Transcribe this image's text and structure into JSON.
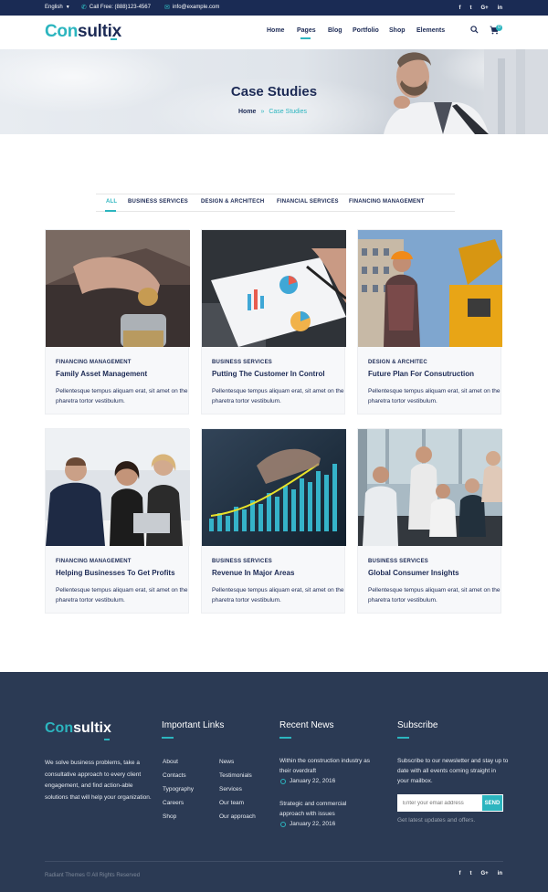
{
  "topbar": {
    "language": "English",
    "phone": "Call Free: (888)123-4567",
    "email": "info@example.com",
    "social": [
      "f",
      "t",
      "G+",
      "in"
    ]
  },
  "header": {
    "logo_part1": "Con",
    "logo_part2": "sultix",
    "nav": [
      "Home",
      "Pages",
      "Blog",
      "Portfolio",
      "Shop",
      "Elements"
    ],
    "active_nav": "Pages",
    "cart_count": "0"
  },
  "hero": {
    "title": "Case Studies",
    "breadcrumb_home": "Home",
    "breadcrumb_sep": "»",
    "breadcrumb_current": "Case Studies"
  },
  "filters": [
    "ALL",
    "BUSINESS SERVICES",
    "DESIGN & ARCHITECH",
    "FINANCIAL SERVICES",
    "FINANCING MANAGEMENT"
  ],
  "cards": [
    {
      "category": "FINANCING MANAGEMENT",
      "title": "Family Asset Management",
      "desc": "Pellentesque tempus aliquam erat, sit amet on the pharetra tortor vestibulum."
    },
    {
      "category": "BUSINESS SERVICES",
      "title": "Putting The Customer In Control",
      "desc": "Pellentesque tempus aliquam erat, sit amet on the pharetra tortor vestibulum."
    },
    {
      "category": "DESIGN & ARCHITEC",
      "title": "Future Plan  For Consutruction",
      "desc": "Pellentesque tempus aliquam erat, sit amet on the pharetra tortor vestibulum."
    },
    {
      "category": "FINANCING MANAGEMENT",
      "title": "Helping Businesses To Get  Profits",
      "desc": "Pellentesque tempus aliquam erat, sit amet on the pharetra tortor vestibulum."
    },
    {
      "category": "BUSINESS SERVICES",
      "title": "Revenue In Major Areas",
      "desc": "Pellentesque tempus aliquam erat, sit amet on the pharetra tortor vestibulum."
    },
    {
      "category": "BUSINESS SERVICES",
      "title": "Global Consumer Insights",
      "desc": "Pellentesque tempus aliquam erat, sit amet on the pharetra tortor vestibulum."
    }
  ],
  "footer": {
    "logo_part1": "Con",
    "logo_part2": "sultix",
    "about": "We solve business problems, take a consultative approach to every client engagement, and find action-able solutions that will help your organization.",
    "links_heading": "Important Links",
    "links_col1": [
      "About",
      "Contacts",
      "Typography",
      "Careers",
      "Shop"
    ],
    "links_col2": [
      "News",
      "Testimonials",
      "Services",
      "Our team",
      "Our approach"
    ],
    "news_heading": "Recent News",
    "news": [
      {
        "title": "Within the construction industry as their overdraft",
        "date": "January 22, 2016"
      },
      {
        "title": "Strategic and commercial approach with issues",
        "date": "January 22, 2016"
      }
    ],
    "subscribe_heading": "Subscribe",
    "subscribe_text": "Subscribe to our newsletter and stay up to date with all events coming straight in your mailbox.",
    "email_placeholder": "Enter your email address",
    "send_label": "SEND",
    "subscribe_note": "Get latest updates and offers.",
    "copyright": "Radiant Themes © All Rights Reserved",
    "social": [
      "f",
      "t",
      "G+",
      "in"
    ]
  },
  "colors": {
    "navy": "#1a2b54",
    "teal": "#2cb5bf",
    "footer_bg": "#2b3a54"
  }
}
